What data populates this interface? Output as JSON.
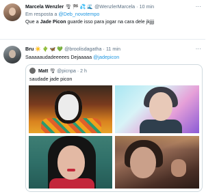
{
  "tweet1": {
    "display_name": "Marcela Wenzler",
    "name_emojis": "🌪 🏁 💦 🌊",
    "handle": "@WenzlerMarcela",
    "separator": "·",
    "time": "10 min",
    "reply_prefix": "Em resposta a",
    "reply_handle": "@Deb_novotempo",
    "text_before": "Que a",
    "text_bold": "Jade Picon",
    "text_after": "guarde isso para jogar na cara dele jkjjjj",
    "more": "..."
  },
  "tweet2": {
    "display_name": "Bru",
    "name_emojis": "☀️ 🌵 🦋 💚",
    "handle": "@broolisdagatha",
    "separator": "·",
    "time": "11 min",
    "text_before": "Saaaaaudadeeeees Dejaaaaa",
    "text_mention": "@jadepicon",
    "more": "...",
    "quote": {
      "display_name": "Matt",
      "name_emojis": "🌪",
      "handle": "@picnpa",
      "separator": "·",
      "time": "2 h",
      "text": "saudade jade picon",
      "photos": [
        "jade-photo-1",
        "jade-photo-2",
        "jade-photo-3",
        "jade-photo-4"
      ]
    }
  },
  "colors": {
    "link": "#1b95e0",
    "muted": "#5b7083",
    "border": "#cfd9de"
  }
}
